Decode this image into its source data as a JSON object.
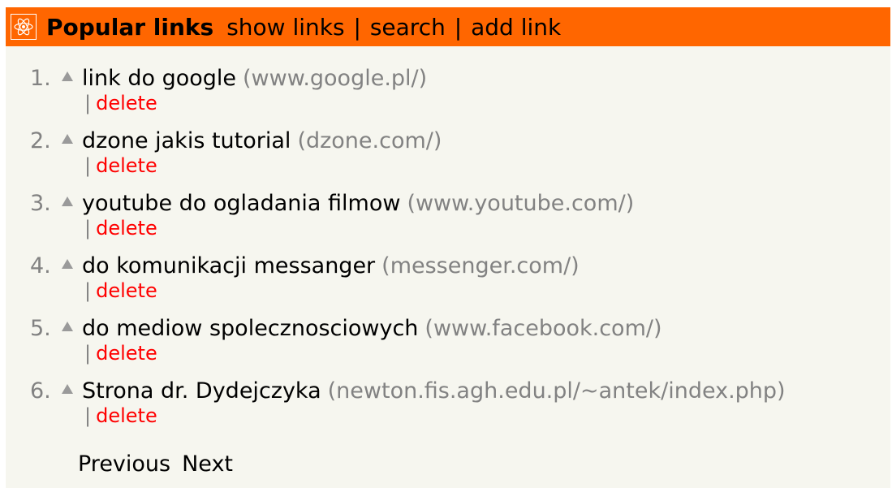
{
  "header": {
    "logo_icon": "atom-icon",
    "title": "Popular links",
    "nav": [
      {
        "label": "show links"
      },
      {
        "label": "search"
      },
      {
        "label": "add link"
      }
    ],
    "separator": "|",
    "bg_color": "#ff6600"
  },
  "links": [
    {
      "rank": "1.",
      "title": "link do google",
      "domain": "(www.google.pl/)",
      "action": "delete"
    },
    {
      "rank": "2.",
      "title": "dzone jakis tutorial",
      "domain": "(dzone.com/)",
      "action": "delete"
    },
    {
      "rank": "3.",
      "title": "youtube do ogladania filmow",
      "domain": "(www.youtube.com/)",
      "action": "delete"
    },
    {
      "rank": "4.",
      "title": "do komunikacji messanger",
      "domain": "(messenger.com/)",
      "action": "delete"
    },
    {
      "rank": "5.",
      "title": "do mediow spolecznosciowych",
      "domain": "(www.facebook.com/)",
      "action": "delete"
    },
    {
      "rank": "6.",
      "title": "Strona dr. Dydejczyka",
      "domain": "(newton.fis.agh.edu.pl/~antek/index.php)",
      "action": "delete"
    }
  ],
  "item_separator": "|",
  "upvote_icon": "upvote-triangle-icon",
  "pager": {
    "previous_label": "Previous",
    "next_label": "Next"
  },
  "colors": {
    "background": "#f6f6ef",
    "muted": "#828282",
    "delete": "#ff0000"
  }
}
